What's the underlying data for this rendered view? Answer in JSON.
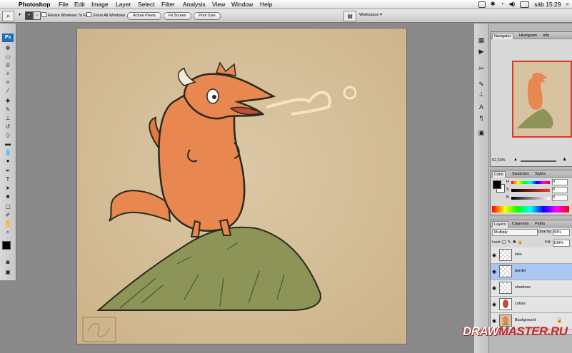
{
  "menubar": {
    "app": "Photoshop",
    "menus": [
      "File",
      "Edit",
      "Image",
      "Layer",
      "Select",
      "Filter",
      "Analysis",
      "View",
      "Window",
      "Help"
    ],
    "clock": "sáb 15:29"
  },
  "options_bar": {
    "resize_windows": "Resize Windows To Fit",
    "zoom_all": "Zoom All Windows",
    "actual_pixels": "Actual Pixels",
    "fit_screen": "Fit Screen",
    "print_size": "Print Size",
    "workspace": "Workspace"
  },
  "toolbox": {
    "badge": "Ps"
  },
  "navigator": {
    "tabs": [
      "Navigator",
      "Histogram",
      "Info"
    ],
    "zoom": "62,33%"
  },
  "color_panel": {
    "tabs": [
      "Color",
      "Swatches",
      "Styles"
    ],
    "channels": [
      {
        "label": "H",
        "value": "0"
      },
      {
        "label": "S",
        "value": "0"
      },
      {
        "label": "B",
        "value": "0"
      }
    ]
  },
  "layers_panel": {
    "tabs": [
      "Layers",
      "Channels",
      "Paths"
    ],
    "blend_mode": "Multiply",
    "opacity_label": "Opacity:",
    "opacity": "80%",
    "lock_label": "Lock:",
    "fill_label": "Fill:",
    "fill": "100%",
    "layers": [
      {
        "name": "inks",
        "selected": false
      },
      {
        "name": "border",
        "selected": true
      },
      {
        "name": "shadows",
        "selected": false
      },
      {
        "name": "colors",
        "selected": false
      },
      {
        "name": "Background",
        "selected": false
      }
    ]
  },
  "watermark": {
    "part1": "DRAW",
    "part2": "MASTER.RU"
  },
  "colors": {
    "canvas": "#d8c3a0",
    "dragon": "#e8874f",
    "hill": "#8c9457",
    "selection": "#a9c7f0"
  }
}
